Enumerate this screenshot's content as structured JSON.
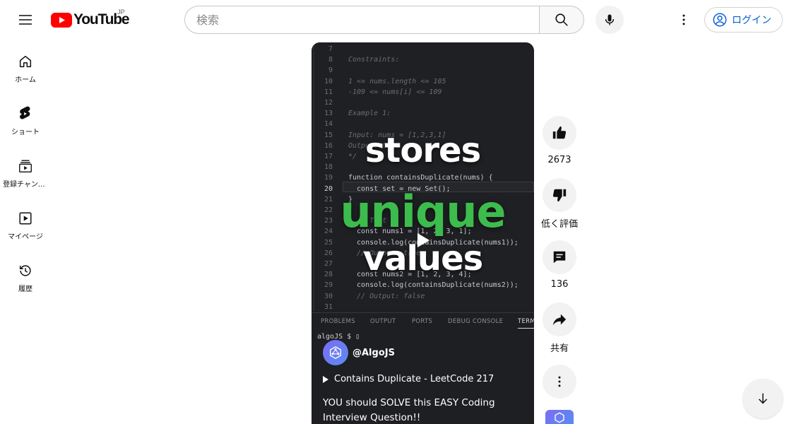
{
  "header": {
    "logo_text": "YouTube",
    "region": "JP",
    "search_placeholder": "検索",
    "login_label": "ログイン"
  },
  "sidebar": {
    "items": [
      {
        "label": "ホーム",
        "icon": "home-icon"
      },
      {
        "label": "ショート",
        "icon": "shorts-icon"
      },
      {
        "label": "登録チャンネル",
        "icon": "subscriptions-icon"
      },
      {
        "label": "マイページ",
        "icon": "my-page-icon"
      },
      {
        "label": "履歴",
        "icon": "history-icon"
      }
    ]
  },
  "video": {
    "code_lines": [
      {
        "n": "7",
        "t": "",
        "c": false
      },
      {
        "n": "8",
        "t": "Constraints:",
        "c": true
      },
      {
        "n": "9",
        "t": "",
        "c": false
      },
      {
        "n": "10",
        "t": "1 <= nums.length <= 105",
        "c": true
      },
      {
        "n": "11",
        "t": "-109 <= nums[i] <= 109",
        "c": true
      },
      {
        "n": "12",
        "t": "",
        "c": false
      },
      {
        "n": "13",
        "t": "Example 1:",
        "c": true
      },
      {
        "n": "14",
        "t": "",
        "c": false
      },
      {
        "n": "15",
        "t": "Input: nums = [1,2,3,1]",
        "c": true
      },
      {
        "n": "16",
        "t": "Output: true",
        "c": true
      },
      {
        "n": "17",
        "t": "*/",
        "c": true
      },
      {
        "n": "18",
        "t": "",
        "c": false
      },
      {
        "n": "19",
        "t": "function containsDuplicate(nums) {",
        "c": false
      },
      {
        "n": "20",
        "t": "  const set = new Set();",
        "c": false
      },
      {
        "n": "21",
        "t": "}",
        "c": false
      },
      {
        "n": "22",
        "t": "",
        "c": false
      },
      {
        "n": "23",
        "t": "  // Test",
        "c": true
      },
      {
        "n": "24",
        "t": "  const nums1 = [1, 2, 3, 1];",
        "c": false
      },
      {
        "n": "25",
        "t": "  console.log(containsDuplicate(nums1));",
        "c": false
      },
      {
        "n": "26",
        "t": "  // Output: true",
        "c": true
      },
      {
        "n": "27",
        "t": "",
        "c": false
      },
      {
        "n": "28",
        "t": "  const nums2 = [1, 2, 3, 4];",
        "c": false
      },
      {
        "n": "29",
        "t": "  console.log(containsDuplicate(nums2));",
        "c": false
      },
      {
        "n": "30",
        "t": "  // Output: false",
        "c": true
      },
      {
        "n": "31",
        "t": "",
        "c": false
      }
    ],
    "panel_tabs": [
      "PROBLEMS",
      "OUTPUT",
      "PORTS",
      "DEBUG CONSOLE",
      "TERMINAL"
    ],
    "terminal_prompt": "algoJS $ ▯",
    "overlay_words": [
      "stores",
      "unique",
      "values"
    ],
    "channel_name": "@AlgoJS",
    "playlist_title": "Contains Duplicate - LeetCode 217",
    "description": "YOU should SOLVE this EASY Coding Interview Question!!"
  },
  "actions": {
    "like_count": "2673",
    "dislike_label": "低く評価",
    "comment_count": "136",
    "share_label": "共有"
  },
  "colors": {
    "brand_red": "#ff0000",
    "accent_blue": "#065fd4",
    "overlay_green": "#3dbc4e"
  }
}
